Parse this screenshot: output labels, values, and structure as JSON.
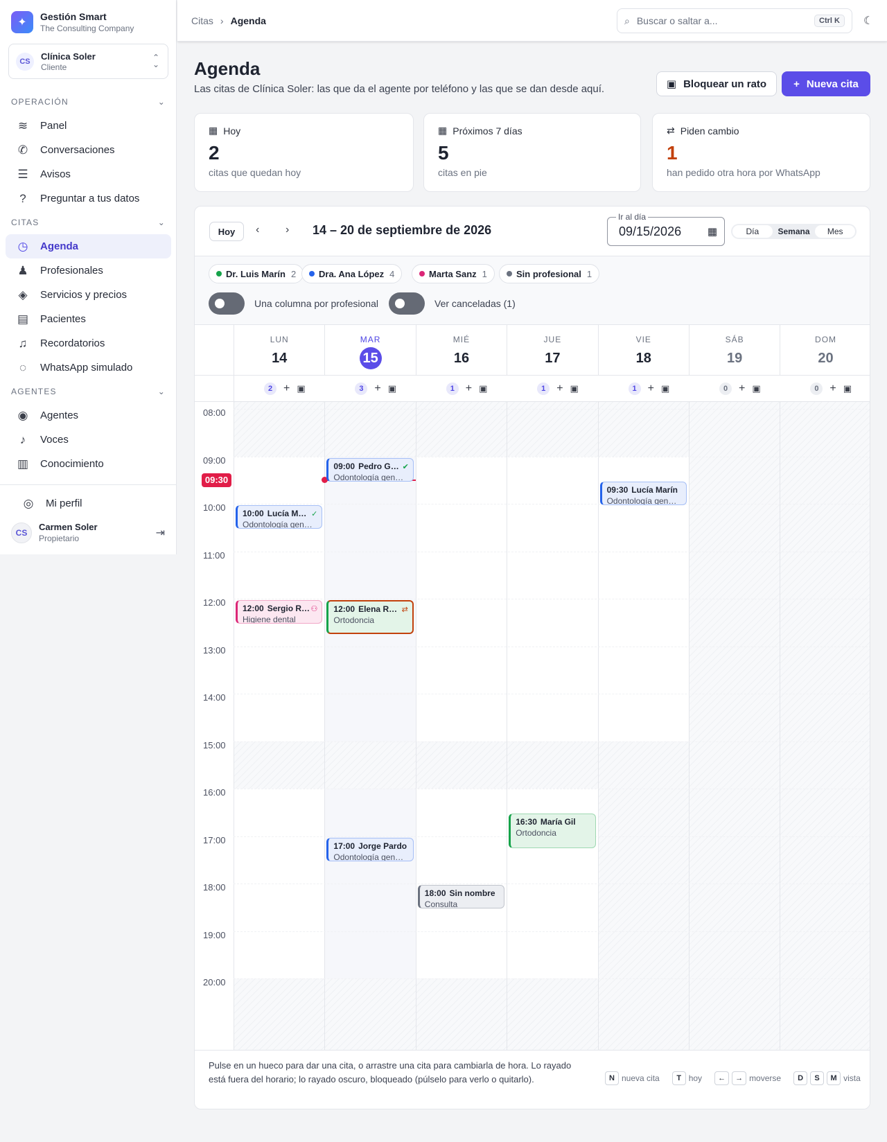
{
  "brand": {
    "title": "Gestión Smart",
    "subtitle": "The Consulting Company"
  },
  "tenant": {
    "initials": "CS",
    "name": "Clínica Soler",
    "role": "Cliente"
  },
  "nav": {
    "sections": [
      {
        "label": "OPERACIÓN",
        "items": [
          {
            "label": "Panel",
            "icon": "waveform-icon"
          },
          {
            "label": "Conversaciones",
            "icon": "phone-icon"
          },
          {
            "label": "Avisos",
            "icon": "list-icon"
          },
          {
            "label": "Preguntar a tus datos",
            "icon": "chat-question-icon"
          }
        ]
      },
      {
        "label": "CITAS",
        "items": [
          {
            "label": "Agenda",
            "icon": "calendar-clock-icon",
            "active": true
          },
          {
            "label": "Profesionales",
            "icon": "person-icon"
          },
          {
            "label": "Servicios y precios",
            "icon": "tag-icon"
          },
          {
            "label": "Pacientes",
            "icon": "id-card-icon"
          },
          {
            "label": "Recordatorios",
            "icon": "bell-icon"
          },
          {
            "label": "WhatsApp simulado",
            "icon": "whatsapp-icon"
          }
        ]
      },
      {
        "label": "AGENTES",
        "items": [
          {
            "label": "Agentes",
            "icon": "robot-icon"
          },
          {
            "label": "Voces",
            "icon": "voice-icon"
          },
          {
            "label": "Conocimiento",
            "icon": "book-icon"
          }
        ]
      }
    ],
    "profile": "Mi perfil"
  },
  "user": {
    "initials": "CS",
    "name": "Carmen Soler",
    "role": "Propietario"
  },
  "breadcrumb": [
    "Citas",
    "Agenda"
  ],
  "search": {
    "placeholder": "Buscar o saltar a...",
    "shortcut": "Ctrl K"
  },
  "header": {
    "title": "Agenda",
    "subtitle": "Las citas de Clínica Soler: las que da el agente por teléfono y las que se dan desde aquí.",
    "block_button": "Bloquear un rato",
    "new_button": "Nueva cita"
  },
  "kpis": [
    {
      "label": "Hoy",
      "value": "2",
      "desc": "citas que quedan hoy",
      "icon": "calendar-icon",
      "color": "#1e2330"
    },
    {
      "label": "Próximos 7 días",
      "value": "5",
      "desc": "citas en pie",
      "icon": "calendar-icon",
      "color": "#1e2330"
    },
    {
      "label": "Piden cambio",
      "value": "1",
      "desc": "han pedido otra hora por WhatsApp",
      "icon": "swap-icon",
      "color": "#c2410c"
    }
  ],
  "calendar": {
    "today_label": "Hoy",
    "range": "14 – 20 de septiembre de 2026",
    "goto_label": "Ir al día",
    "goto_value": "09/15/2026",
    "views": [
      "Día",
      "Semana",
      "Mes"
    ],
    "active_view": "Semana",
    "professionals": [
      {
        "name": "Dr. Luis Marín",
        "count": "2",
        "color": "#16a34a"
      },
      {
        "name": "Dra. Ana López",
        "count": "4",
        "color": "#2563eb"
      },
      {
        "name": "Marta Sanz",
        "count": "1",
        "color": "#db2777"
      },
      {
        "name": "Sin profesional",
        "count": "1",
        "color": "#6b7280"
      }
    ],
    "toggles": [
      "Una columna por profesional",
      "Ver canceladas (1)"
    ],
    "days": [
      {
        "name": "LUN",
        "num": "14",
        "count": "2"
      },
      {
        "name": "MAR",
        "num": "15",
        "count": "3",
        "today": true
      },
      {
        "name": "MIÉ",
        "num": "16",
        "count": "1"
      },
      {
        "name": "JUE",
        "num": "17",
        "count": "1"
      },
      {
        "name": "VIE",
        "num": "18",
        "count": "1"
      },
      {
        "name": "SÁB",
        "num": "19",
        "count": "0",
        "weekend": true
      },
      {
        "name": "DOM",
        "num": "20",
        "count": "0",
        "weekend": true
      }
    ],
    "hours": [
      "08:00",
      "09:00",
      "10:00",
      "11:00",
      "12:00",
      "13:00",
      "14:00",
      "15:00",
      "16:00",
      "17:00",
      "18:00",
      "19:00",
      "20:00"
    ],
    "now_label": "09:30",
    "now_time": "09:30",
    "appointments": [
      {
        "day": 0,
        "start": "10:00",
        "end": "10:30",
        "title": "Lucía Martínez",
        "service": "Odontología general",
        "color": "#2563eb",
        "bg": "#e8eefc",
        "icon": "person-check-icon"
      },
      {
        "day": 0,
        "start": "12:00",
        "end": "12:30",
        "title": "Sergio Ruiz",
        "service": "Higiene dental",
        "color": "#db2777",
        "bg": "#fce7f1",
        "icon": "people-icon"
      },
      {
        "day": 1,
        "start": "09:00",
        "end": "09:30",
        "title": "Pedro Gómez",
        "service": "Odontología general",
        "color": "#2563eb",
        "bg": "#e8eefc",
        "icon": "check-circle-icon"
      },
      {
        "day": 1,
        "start": "12:00",
        "end": "12:45",
        "title": "Elena Romero",
        "service": "Ortodoncia",
        "color": "#16a34a",
        "bg": "#e3f4e8",
        "icon": "swap-icon",
        "flag": true
      },
      {
        "day": 1,
        "start": "17:00",
        "end": "17:30",
        "title": "Jorge Pardo",
        "service": "Odontología general",
        "color": "#2563eb",
        "bg": "#e8eefc"
      },
      {
        "day": 2,
        "start": "18:00",
        "end": "18:30",
        "title": "Sin nombre",
        "service": "Consulta",
        "color": "#6b7280",
        "bg": "#eceef2"
      },
      {
        "day": 3,
        "start": "16:30",
        "end": "17:15",
        "title": "María Gil",
        "service": "Ortodoncia",
        "color": "#16a34a",
        "bg": "#e3f4e8"
      },
      {
        "day": 4,
        "start": "09:30",
        "end": "10:00",
        "title": "Lucía Marín",
        "service": "Odontología general",
        "color": "#2563eb",
        "bg": "#e8eefc"
      }
    ],
    "footer": {
      "help": "Pulse en un hueco para dar una cita, o arrastre una cita para cambiarla de hora. Lo rayado está fuera del horario; lo rayado oscuro, bloqueado (púlselo para verlo o quitarlo).",
      "shortcuts": [
        {
          "keys": [
            "N"
          ],
          "label": "nueva cita"
        },
        {
          "keys": [
            "T"
          ],
          "label": "hoy"
        },
        {
          "keys": [
            "←",
            "→"
          ],
          "label": "moverse"
        },
        {
          "keys": [
            "D",
            "S",
            "M"
          ],
          "label": "vista"
        }
      ]
    }
  }
}
